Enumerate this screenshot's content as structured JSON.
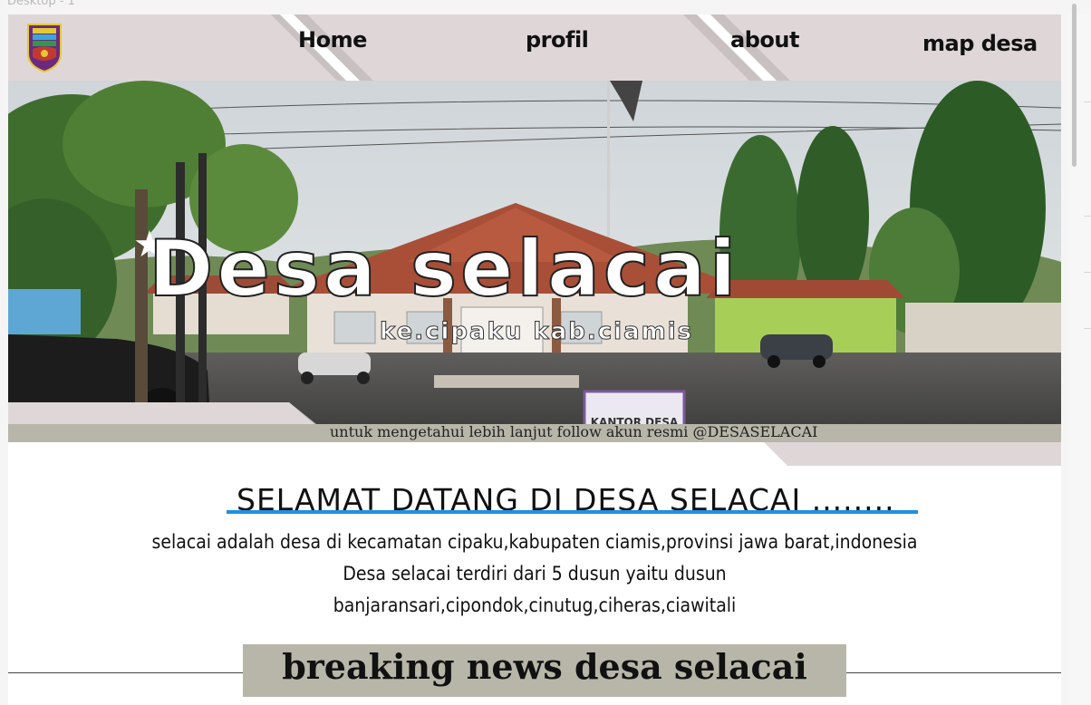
{
  "frame": {
    "label": "Desktop - 1"
  },
  "header": {
    "nav": [
      {
        "label": "Home"
      },
      {
        "label": "profil"
      },
      {
        "label": "about"
      },
      {
        "label": "map desa"
      }
    ]
  },
  "hero": {
    "title": "Desa selacai",
    "subtitle": "ke.cipaku kab.ciamis",
    "sign_text": "KANTOR DESA"
  },
  "follow": {
    "text": "untuk mengetahui lebih lanjut follow akun resmi @DESASELACAI"
  },
  "welcome": {
    "title": "SELAMAT DATANG DI DESA SELACAI ........",
    "line1": "selacai adalah desa di kecamatan cipaku,kabupaten ciamis,provinsi jawa barat,indonesia",
    "line2": "Desa selacai terdiri dari 5 dusun yaitu dusun",
    "line3": "banjaransari,cipondok,cinutug,ciheras,ciawitali"
  },
  "news": {
    "title": "breaking news desa selacai"
  },
  "colors": {
    "header_bg": "#dfd7d7",
    "band_olive": "#b7b6a8",
    "underline_blue": "#1e90e6"
  }
}
